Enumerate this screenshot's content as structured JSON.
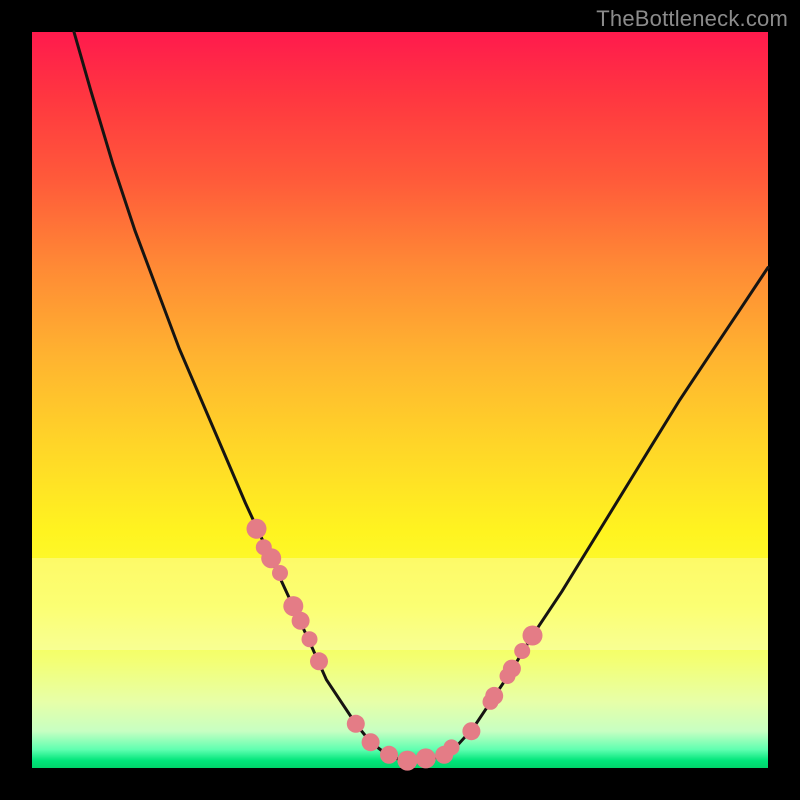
{
  "watermark_text": "TheBottleneck.com",
  "colors": {
    "page_bg": "#000000",
    "curve_stroke": "#161412",
    "bead_fill": "#e47c86",
    "gradient_top": "#ff1a4d",
    "gradient_bottom": "#00d46a"
  },
  "chart_data": {
    "type": "line",
    "title": "",
    "xlabel": "",
    "ylabel": "",
    "xlim": [
      0,
      100
    ],
    "ylim": [
      0,
      100
    ],
    "grid": false,
    "legend": false,
    "series": [
      {
        "name": "bottleneck-curve",
        "x": [
          5.7,
          8.0,
          11.0,
          14.0,
          17.0,
          20.0,
          23.0,
          26.0,
          29.0,
          32.0,
          35.0,
          38.0,
          40.0,
          42.0,
          44.0,
          46.0,
          48.0,
          50.0,
          52.0,
          54.0,
          56.0,
          58.0,
          60.0,
          62.0,
          65.0,
          68.0,
          72.0,
          76.0,
          80.0,
          84.0,
          88.0,
          92.0,
          96.0,
          100.0
        ],
        "y": [
          100.0,
          92.0,
          82.0,
          73.0,
          65.0,
          57.0,
          50.0,
          43.0,
          36.0,
          29.5,
          23.0,
          16.5,
          12.0,
          9.0,
          6.0,
          3.5,
          2.0,
          1.1,
          1.0,
          1.1,
          1.8,
          3.3,
          5.5,
          8.5,
          13.0,
          18.0,
          24.0,
          30.5,
          37.0,
          43.5,
          50.0,
          56.0,
          62.0,
          68.0
        ]
      }
    ],
    "markers": {
      "name": "highlight-beads",
      "x": [
        30.5,
        31.5,
        32.5,
        33.7,
        35.5,
        36.5,
        37.7,
        39.0,
        44.0,
        46.0,
        48.5,
        51.0,
        53.5,
        56.0,
        57.0,
        59.7,
        62.3,
        62.8,
        64.6,
        65.2,
        66.6,
        68.0
      ],
      "y": [
        32.5,
        30.0,
        28.5,
        26.5,
        22.0,
        20.0,
        17.5,
        14.5,
        6.0,
        3.5,
        1.8,
        1.0,
        1.3,
        1.8,
        2.8,
        5.0,
        9.0,
        9.8,
        12.5,
        13.5,
        15.9,
        18.0
      ],
      "r": [
        10,
        8,
        10,
        8,
        10,
        9,
        8,
        9,
        9,
        9,
        9,
        10,
        10,
        9,
        8,
        9,
        8,
        9,
        8,
        9,
        8,
        10
      ]
    }
  }
}
